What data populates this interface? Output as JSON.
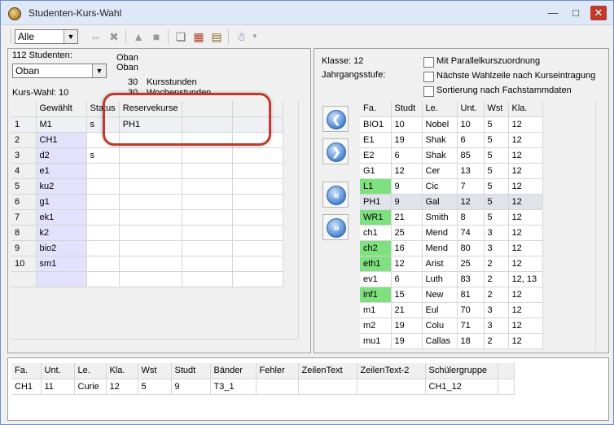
{
  "window": {
    "title": "Studenten-Kurs-Wahl"
  },
  "toolbar": {
    "filter_value": "Alle"
  },
  "left": {
    "students_count": "112 Studenten:",
    "level_value": "Oban",
    "level_text_1": "Oban",
    "level_text_2": "Oban",
    "kurs_wahl": "Kurs-Wahl: 10",
    "kursstunden_num": "30",
    "kursstunden_label": "Kursstunden",
    "wochenstunden_num": "30",
    "wochenstunden_label": "Wochenstunden",
    "headers": [
      "",
      "Gewählt",
      "Status",
      "Reservekurse",
      "",
      ""
    ],
    "rows": [
      [
        "1",
        "M1",
        "s",
        "PH1",
        "",
        ""
      ],
      [
        "2",
        "CH1",
        "",
        "",
        "",
        ""
      ],
      [
        "3",
        "d2",
        "s",
        "",
        "",
        ""
      ],
      [
        "4",
        "e1",
        "",
        "",
        "",
        ""
      ],
      [
        "5",
        "ku2",
        "",
        "",
        "",
        ""
      ],
      [
        "6",
        "g1",
        "",
        "",
        "",
        ""
      ],
      [
        "7",
        "ek1",
        "",
        "",
        "",
        ""
      ],
      [
        "8",
        "k2",
        "",
        "",
        "",
        ""
      ],
      [
        "9",
        "bio2",
        "",
        "",
        "",
        ""
      ],
      [
        "10",
        "sm1",
        "",
        "",
        "",
        ""
      ],
      [
        "",
        "",
        "",
        "",
        "",
        ""
      ]
    ]
  },
  "right": {
    "klasse": "Klasse: 12",
    "jahrgangsstufe": "Jahrgangsstufe:",
    "options": [
      "Mit Parallelkurszuordnung",
      "Nächste Wahlzeile nach Kurseintragung",
      "Sortierung nach Fachstammdaten"
    ],
    "headers": [
      "Fa.",
      "Studt",
      "Le.",
      "Unt.",
      "Wst",
      "Kla."
    ],
    "rows": [
      [
        "BIO1",
        "10",
        "Nobel",
        "10",
        "5",
        "12"
      ],
      [
        "E1",
        "19",
        "Shak",
        "6",
        "5",
        "12"
      ],
      [
        "E2",
        "6",
        "Shak",
        "85",
        "5",
        "12"
      ],
      [
        "G1",
        "12",
        "Cer",
        "13",
        "5",
        "12"
      ],
      [
        "L1",
        "9",
        "Cic",
        "7",
        "5",
        "12"
      ],
      [
        "PH1",
        "9",
        "Gal",
        "12",
        "5",
        "12"
      ],
      [
        "WR1",
        "21",
        "Smith",
        "8",
        "5",
        "12"
      ],
      [
        "ch1",
        "25",
        "Mend",
        "74",
        "3",
        "12"
      ],
      [
        "ch2",
        "16",
        "Mend",
        "80",
        "3",
        "12"
      ],
      [
        "eth1",
        "12",
        "Arist",
        "25",
        "2",
        "12"
      ],
      [
        "ev1",
        "6",
        "Luth",
        "83",
        "2",
        "12, 13"
      ],
      [
        "inf1",
        "15",
        "New",
        "81",
        "2",
        "12"
      ],
      [
        "m1",
        "21",
        "Eul",
        "70",
        "3",
        "12"
      ],
      [
        "m2",
        "19",
        "Colu",
        "71",
        "3",
        "12"
      ],
      [
        "mu1",
        "19",
        "Callas",
        "18",
        "2",
        "12"
      ]
    ],
    "green_rows": [
      4,
      6,
      8,
      9,
      11
    ],
    "highlight_row": 5
  },
  "bottom": {
    "headers": [
      "Fa.",
      "Unt.",
      "Le.",
      "Kla.",
      "Wst",
      "Studt",
      "Bänder",
      "Fehler",
      "ZeilenText",
      "ZeilenText-2",
      "Schülergruppe",
      ""
    ],
    "row": [
      "CH1",
      "11",
      "Curie",
      "12",
      "5",
      "9",
      "T3_1",
      "",
      "",
      "",
      "CH1_12",
      ""
    ]
  },
  "colors": {
    "selected_column": "#e3e1fb",
    "green_cell": "#7ee07e",
    "annotation": "#c0392b"
  }
}
